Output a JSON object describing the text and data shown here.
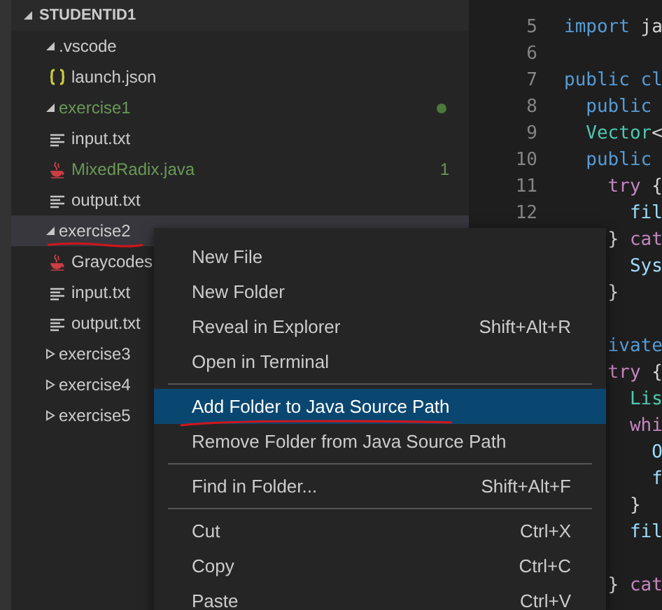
{
  "explorer": {
    "title": "STUDENTID1",
    "expanded": true,
    "items": [
      {
        "kind": "folder",
        "label": ".vscode",
        "expanded": true,
        "children": [
          {
            "kind": "json",
            "label": "launch.json"
          }
        ]
      },
      {
        "kind": "folder",
        "label": "exercise1",
        "expanded": true,
        "modified": true,
        "children": [
          {
            "kind": "text",
            "label": "input.txt"
          },
          {
            "kind": "java",
            "label": "MixedRadix.java",
            "modified": true,
            "badge": "1"
          },
          {
            "kind": "text",
            "label": "output.txt"
          }
        ]
      },
      {
        "kind": "folder",
        "label": "exercise2",
        "expanded": true,
        "hovered": true,
        "annotated": true,
        "children": [
          {
            "kind": "java",
            "label": "Graycodes"
          },
          {
            "kind": "text",
            "label": "input.txt"
          },
          {
            "kind": "text",
            "label": "output.txt"
          }
        ]
      },
      {
        "kind": "folder",
        "label": "exercise3",
        "expanded": false
      },
      {
        "kind": "folder",
        "label": "exercise4",
        "expanded": false
      },
      {
        "kind": "folder",
        "label": "exercise5",
        "expanded": false
      }
    ]
  },
  "editor": {
    "lines": [
      {
        "kind": "code",
        "number": "5",
        "tokens": [
          {
            "kind": "keyword",
            "text": "import"
          },
          {
            "kind": "plain",
            "text": " ja"
          }
        ]
      },
      {
        "kind": "blank",
        "number": "6"
      },
      {
        "kind": "code",
        "number": "7",
        "tokens": [
          {
            "kind": "keyword",
            "text": "public cl"
          }
        ]
      },
      {
        "kind": "code",
        "number": "8",
        "tokens": [
          {
            "kind": "keyword",
            "text": "  public"
          }
        ]
      },
      {
        "kind": "code",
        "number": "9",
        "tokens": [
          {
            "kind": "type",
            "text": "  Vector"
          },
          {
            "kind": "plain",
            "text": "<"
          }
        ]
      },
      {
        "kind": "code",
        "number": "10",
        "tokens": [
          {
            "kind": "keyword",
            "text": "  public"
          }
        ]
      },
      {
        "kind": "code",
        "number": "11",
        "tokens": [
          {
            "kind": "control",
            "text": "    try"
          },
          {
            "kind": "plain",
            "text": " {"
          }
        ]
      },
      {
        "kind": "code",
        "number": "12",
        "tokens": [
          {
            "kind": "variable",
            "text": "      fil"
          }
        ]
      },
      {
        "kind": "code",
        "tokens": [
          {
            "kind": "plain",
            "text": "    }"
          },
          {
            "kind": "control",
            "text": " cat"
          }
        ]
      },
      {
        "kind": "code",
        "tokens": [
          {
            "kind": "variable",
            "text": "      Sys"
          }
        ]
      },
      {
        "kind": "code",
        "tokens": [
          {
            "kind": "plain",
            "text": "    }"
          }
        ]
      },
      {
        "kind": "blank"
      },
      {
        "kind": "code",
        "tokens": [
          {
            "kind": "keyword",
            "text": "    ivate"
          }
        ]
      },
      {
        "kind": "code",
        "tokens": [
          {
            "kind": "control",
            "text": "    try"
          },
          {
            "kind": "plain",
            "text": " {"
          }
        ]
      },
      {
        "kind": "code",
        "tokens": [
          {
            "kind": "type",
            "text": "      Lis"
          }
        ]
      },
      {
        "kind": "code",
        "tokens": [
          {
            "kind": "control",
            "text": "      whi"
          }
        ]
      },
      {
        "kind": "code",
        "tokens": [
          {
            "kind": "variable",
            "text": "        O"
          }
        ]
      },
      {
        "kind": "code",
        "tokens": [
          {
            "kind": "variable",
            "text": "        f"
          }
        ]
      },
      {
        "kind": "code",
        "tokens": [
          {
            "kind": "plain",
            "text": "      }"
          }
        ]
      },
      {
        "kind": "code",
        "tokens": [
          {
            "kind": "variable",
            "text": "      fil"
          }
        ]
      },
      {
        "kind": "blank"
      },
      {
        "kind": "code",
        "tokens": [
          {
            "kind": "plain",
            "text": "    }"
          },
          {
            "kind": "control",
            "text": " cat"
          }
        ]
      }
    ]
  },
  "context_menu": {
    "groups": [
      [
        {
          "label": "New File",
          "selected": false
        },
        {
          "label": "New Folder",
          "selected": false
        },
        {
          "label": "Reveal in Explorer",
          "shortcut": "Shift+Alt+R",
          "selected": false
        },
        {
          "label": "Open in Terminal",
          "selected": false
        }
      ],
      [
        {
          "label": "Add Folder to Java Source Path",
          "selected": true,
          "annotated": true
        },
        {
          "label": "Remove Folder from Java Source Path",
          "selected": false
        }
      ],
      [
        {
          "label": "Find in Folder...",
          "shortcut": "Shift+Alt+F",
          "selected": false
        }
      ],
      [
        {
          "label": "Cut",
          "shortcut": "Ctrl+X",
          "selected": false
        },
        {
          "label": "Copy",
          "shortcut": "Ctrl+C",
          "selected": false
        },
        {
          "label": "Paste",
          "shortcut": "Ctrl+V",
          "selected": false
        }
      ]
    ]
  }
}
